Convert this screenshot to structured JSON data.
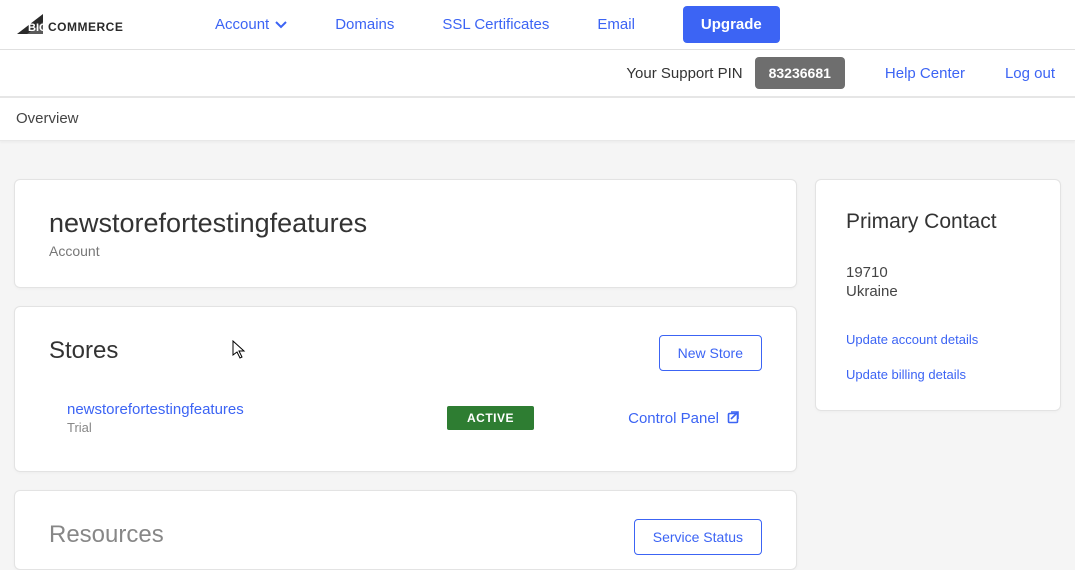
{
  "brand": {
    "name": "BIGCOMMERCE"
  },
  "nav": {
    "account": "Account",
    "domains": "Domains",
    "ssl": "SSL Certificates",
    "email": "Email",
    "upgrade": "Upgrade"
  },
  "support": {
    "label": "Your Support PIN",
    "pin": "83236681",
    "help": "Help Center",
    "logout": "Log out"
  },
  "breadcrumb": {
    "overview": "Overview"
  },
  "account_card": {
    "title": "newstorefortestingfeatures",
    "subtitle": "Account"
  },
  "stores": {
    "heading": "Stores",
    "new_store": "New Store",
    "items": [
      {
        "name": "newstorefortestingfeatures",
        "plan": "Trial",
        "status": "ACTIVE",
        "action": "Control Panel"
      }
    ]
  },
  "resources": {
    "heading": "Resources",
    "service_status": "Service Status"
  },
  "contact": {
    "heading": "Primary Contact",
    "zip": "19710",
    "country": "Ukraine",
    "update_account": "Update account details",
    "update_billing": "Update billing details"
  }
}
